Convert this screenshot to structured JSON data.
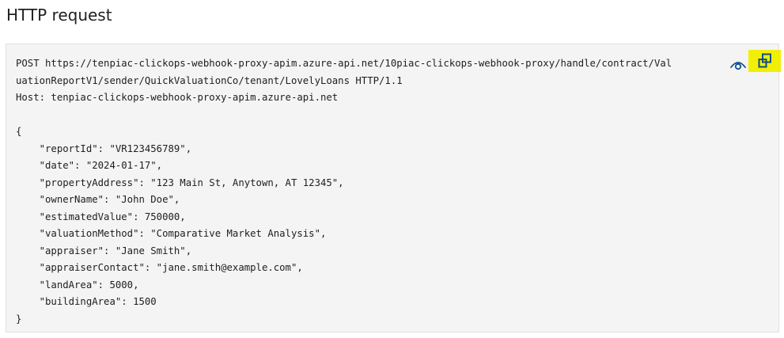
{
  "section": {
    "title": "HTTP request"
  },
  "request": {
    "lines": [
      "POST https://tenpiac-clickops-webhook-proxy-apim.azure-api.net/10piac-clickops-webhook-proxy/handle/contract/Val",
      "uationReportV1/sender/QuickValuationCo/tenant/LovelyLoans HTTP/1.1",
      "Host: tenpiac-clickops-webhook-proxy-apim.azure-api.net",
      "",
      "{",
      "    \"reportId\": \"VR123456789\",",
      "    \"date\": \"2024-01-17\",",
      "    \"propertyAddress\": \"123 Main St, Anytown, AT 12345\",",
      "    \"ownerName\": \"John Doe\",",
      "    \"estimatedValue\": 750000,",
      "    \"valuationMethod\": \"Comparative Market Analysis\",",
      "    \"appraiser\": \"Jane Smith\",",
      "    \"appraiserContact\": \"jane.smith@example.com\",",
      "    \"landArea\": 5000,",
      "    \"buildingArea\": 1500",
      "}"
    ]
  },
  "icons": {
    "visibility": "eye-icon",
    "copy": "copy-icon"
  },
  "colors": {
    "code_background": "#f4f4f4",
    "copy_highlight": "#f2ef06",
    "icon_blue": "#0e4f8a"
  }
}
